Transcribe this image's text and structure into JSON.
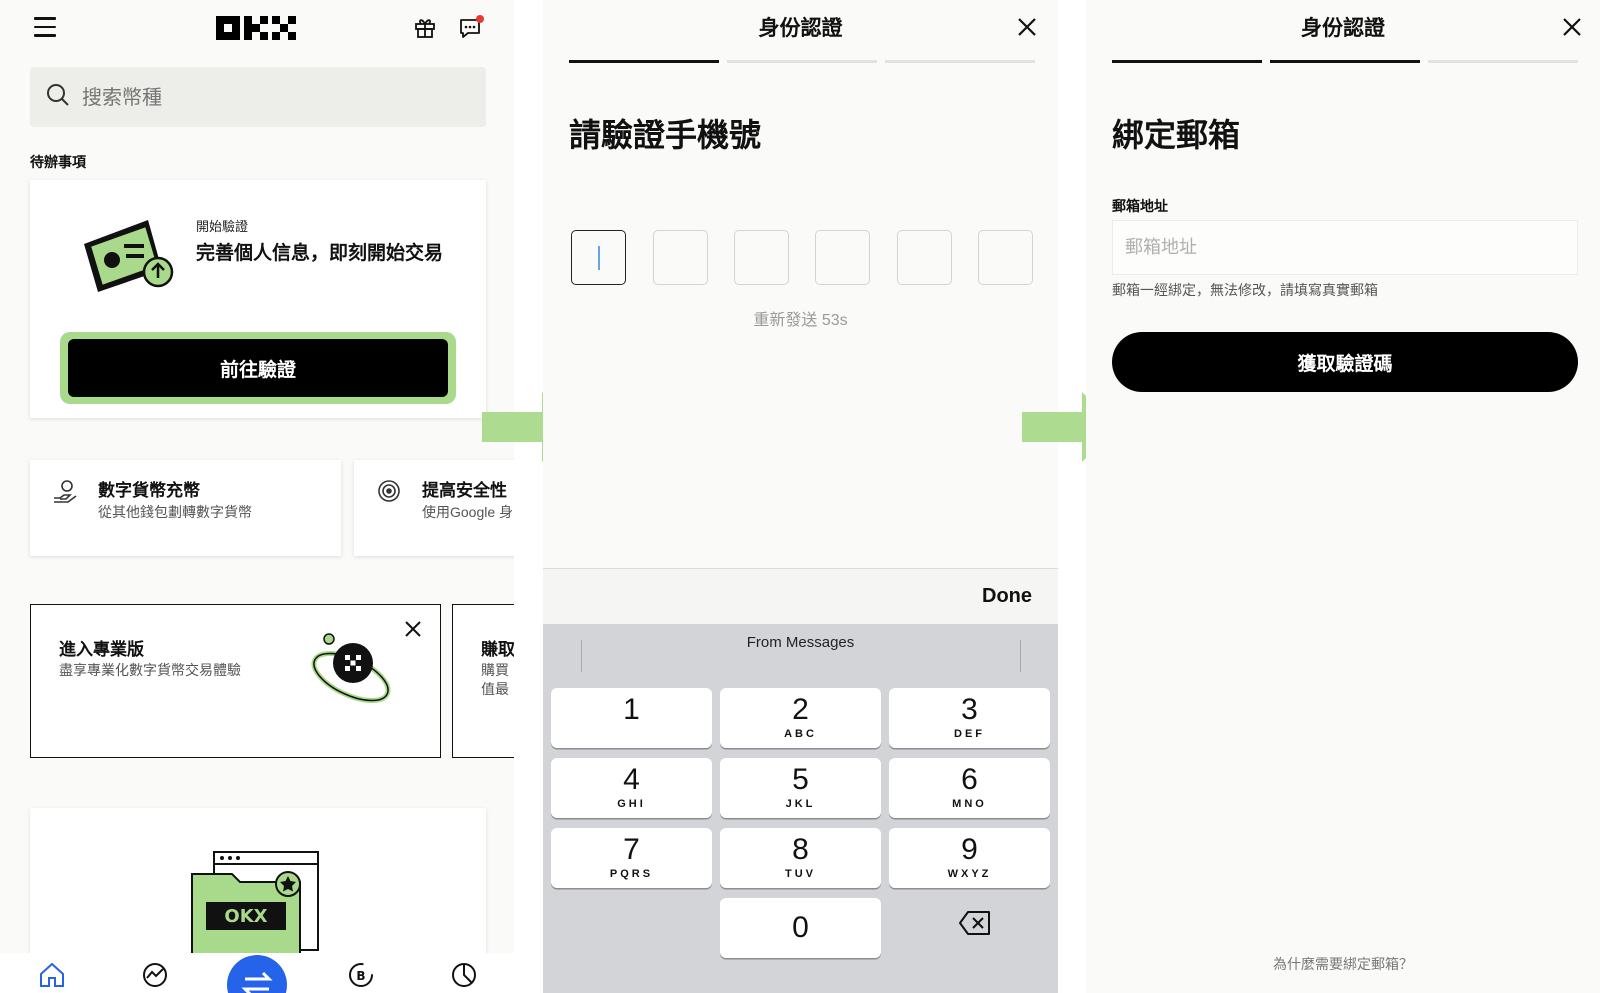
{
  "panel1": {
    "search": {
      "placeholder": "搜索幣種"
    },
    "section_label": "待辦事項",
    "todo": {
      "subtitle": "開始驗證",
      "title": "完善個人信息，即刻開始交易",
      "button_label": "前往驗證"
    },
    "quick_cards": [
      {
        "title": "數字貨幣充幣",
        "desc": "從其他錢包劃轉數字貨幣",
        "icon": "deposit-icon"
      },
      {
        "title": "提高安全性",
        "desc": "使用Google 身",
        "icon": "security-icon"
      }
    ],
    "promo_cards": [
      {
        "title": "進入專業版",
        "desc": "盡享專業化數字貨幣交易體驗"
      },
      {
        "title": "賺取",
        "desc_line1": "購買",
        "desc_line2": "值最"
      }
    ],
    "tabbar": [
      "home-icon",
      "markets-icon",
      "trade-icon",
      "earn-icon",
      "assets-icon"
    ],
    "colors": {
      "trade_button": "#2563eb",
      "highlight": "#a9d98a"
    }
  },
  "panel2": {
    "header_title": "身份認證",
    "page_title": "請驗證手機號",
    "resend": "重新發送  53s",
    "keyboard": {
      "done": "Done",
      "suggestion": "From Messages",
      "keys": [
        {
          "num": "1",
          "letters": ""
        },
        {
          "num": "2",
          "letters": "ABC"
        },
        {
          "num": "3",
          "letters": "DEF"
        },
        {
          "num": "4",
          "letters": "GHI"
        },
        {
          "num": "5",
          "letters": "JKL"
        },
        {
          "num": "6",
          "letters": "MNO"
        },
        {
          "num": "7",
          "letters": "PQRS"
        },
        {
          "num": "8",
          "letters": "TUV"
        },
        {
          "num": "9",
          "letters": "WXYZ"
        },
        {
          "num": "0",
          "letters": ""
        }
      ]
    }
  },
  "panel3": {
    "header_title": "身份認證",
    "page_title": "綁定郵箱",
    "field_label": "郵箱地址",
    "field_placeholder": "郵箱地址",
    "hint": "郵箱一經綁定，無法修改，請填寫真實郵箱",
    "button_label": "獲取驗證碼",
    "why_link": "為什麼需要綁定郵箱？"
  }
}
